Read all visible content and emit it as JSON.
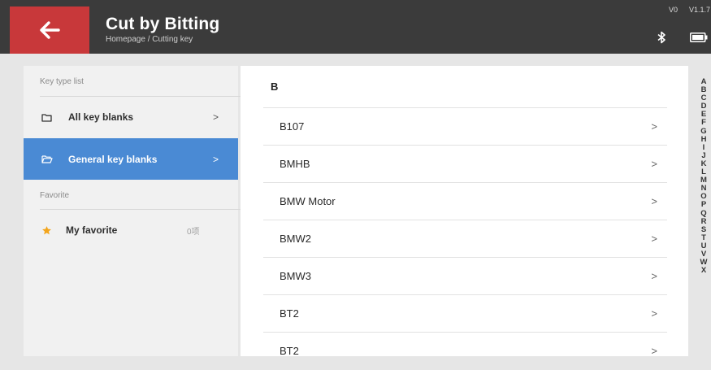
{
  "header": {
    "title": "Cut by Bitting",
    "breadcrumb": "Homepage / Cutting key",
    "version_left": "V0",
    "version_right": "V1.1.7",
    "icons": {
      "back": "arrow-left-icon",
      "bluetooth": "bluetooth-icon",
      "battery": "battery-icon"
    }
  },
  "colors": {
    "header_bg": "#3b3b3b",
    "back_button_bg": "#c8383a",
    "active_item_bg": "#4a8ad4",
    "star": "#f3a51c"
  },
  "sidebar": {
    "key_type_label": "Key type list",
    "items": [
      {
        "label": "All key blanks",
        "icon": "folder-icon",
        "chevron": ">"
      },
      {
        "label": "General key blanks",
        "icon": "folder-open-icon",
        "chevron": ">",
        "active": true
      }
    ],
    "favorite_label": "Favorite",
    "favorite_item": {
      "label": "My favorite",
      "icon": "star-icon",
      "count": "0项"
    }
  },
  "list": {
    "section_letter": "B",
    "items": [
      {
        "label": "B107",
        "chevron": ">"
      },
      {
        "label": "BMHB",
        "chevron": ">"
      },
      {
        "label": "BMW Motor",
        "chevron": ">"
      },
      {
        "label": "BMW2",
        "chevron": ">"
      },
      {
        "label": "BMW3",
        "chevron": ">"
      },
      {
        "label": "BT2",
        "chevron": ">"
      },
      {
        "label": "BT2",
        "chevron": ">"
      }
    ]
  },
  "alphabet": [
    "A",
    "B",
    "C",
    "D",
    "E",
    "F",
    "G",
    "H",
    "I",
    "J",
    "K",
    "L",
    "M",
    "N",
    "O",
    "P",
    "Q",
    "R",
    "S",
    "T",
    "U",
    "V",
    "W",
    "X"
  ]
}
